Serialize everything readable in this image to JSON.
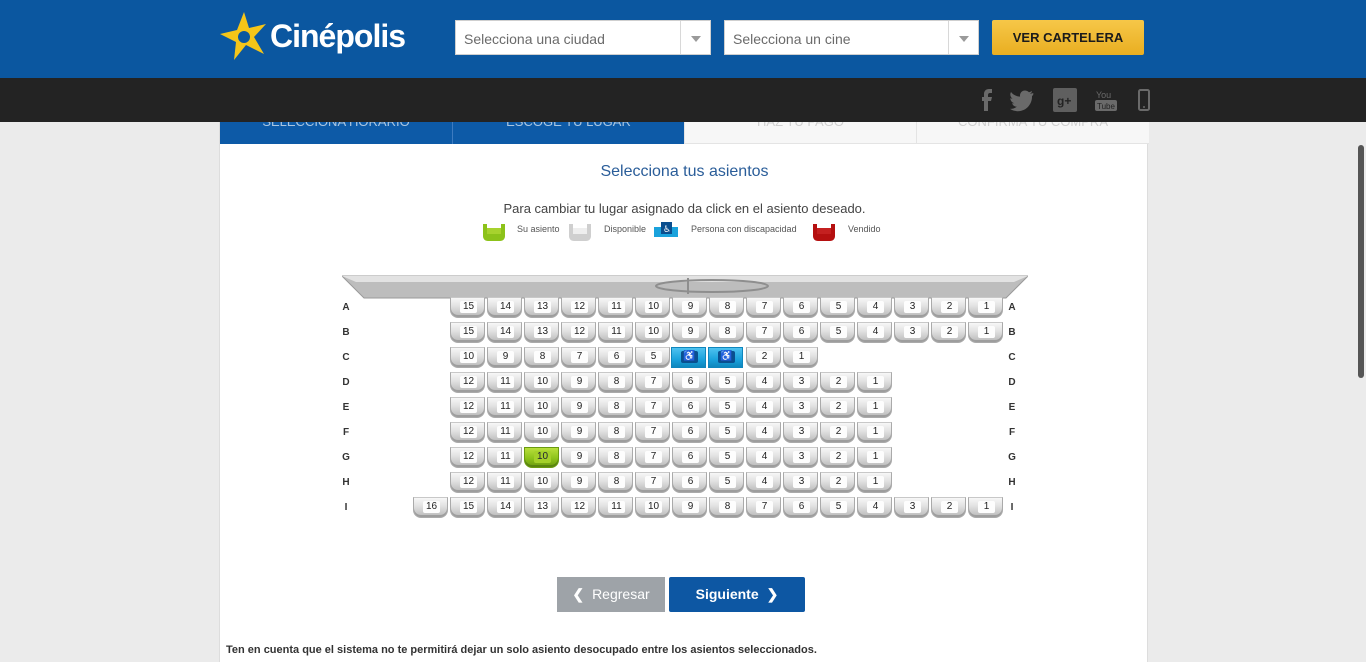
{
  "header": {
    "brand": "Cinépolis",
    "city_select": {
      "placeholder": "Selecciona una ciudad"
    },
    "cinema_select": {
      "placeholder": "Selecciona un cine"
    },
    "cta_label": "VER CARTELERA",
    "colors": {
      "header_bg": "#0b57a0",
      "cta": "#e9ae21",
      "social_bar": "#232323"
    },
    "social_icons": [
      "facebook-icon",
      "twitter-icon",
      "google-plus-icon",
      "youtube-icon",
      "mobile-icon"
    ]
  },
  "steps": [
    {
      "label": "SELECCIONA HORARIO",
      "state": "done"
    },
    {
      "label": "ESCOGE TU LUGAR",
      "state": "current"
    },
    {
      "label": "HAZ TU PAGO",
      "state": "pending"
    },
    {
      "label": "CONFIRMA TU COMPRA",
      "state": "pending"
    }
  ],
  "seatmap": {
    "title": "Selecciona tus asientos",
    "subtitle": "Para cambiar tu lugar asignado da click en el asiento deseado.",
    "legend": {
      "mine": "Su asiento",
      "available": "Disponible",
      "disabled": "Persona con discapacidad",
      "sold": "Vendido"
    },
    "rows": [
      {
        "label": "A",
        "seats": [
          "15",
          "14",
          "13",
          "12",
          "11",
          "10",
          "9",
          "8",
          "7",
          "6",
          "5",
          "4",
          "3",
          "2",
          "1"
        ]
      },
      {
        "label": "B",
        "seats": [
          "15",
          "14",
          "13",
          "12",
          "11",
          "10",
          "9",
          "8",
          "7",
          "6",
          "5",
          "4",
          "3",
          "2",
          "1"
        ]
      },
      {
        "label": "C",
        "seats": [
          "10",
          "9",
          "8",
          "7",
          "6",
          "5",
          "♿",
          "♿",
          "2",
          "1"
        ]
      },
      {
        "label": "D",
        "seats": [
          "12",
          "11",
          "10",
          "9",
          "8",
          "7",
          "6",
          "5",
          "4",
          "3",
          "2",
          "1"
        ]
      },
      {
        "label": "E",
        "seats": [
          "12",
          "11",
          "10",
          "9",
          "8",
          "7",
          "6",
          "5",
          "4",
          "3",
          "2",
          "1"
        ]
      },
      {
        "label": "F",
        "seats": [
          "12",
          "11",
          "10",
          "9",
          "8",
          "7",
          "6",
          "5",
          "4",
          "3",
          "2",
          "1"
        ]
      },
      {
        "label": "G",
        "seats": [
          "12",
          "11",
          "10",
          "9",
          "8",
          "7",
          "6",
          "5",
          "4",
          "3",
          "2",
          "1"
        ]
      },
      {
        "label": "H",
        "seats": [
          "12",
          "11",
          "10",
          "9",
          "8",
          "7",
          "6",
          "5",
          "4",
          "3",
          "2",
          "1"
        ]
      },
      {
        "label": "I",
        "seats": [
          "16",
          "15",
          "14",
          "13",
          "12",
          "11",
          "10",
          "9",
          "8",
          "7",
          "6",
          "5",
          "4",
          "3",
          "2",
          "1"
        ]
      }
    ],
    "selected": {
      "row": "G",
      "seat": "10"
    },
    "disabled_seats": {
      "row": "C"
    }
  },
  "actions": {
    "back_label": "Regresar",
    "next_label": "Siguiente"
  },
  "note": "Ten en cuenta que el sistema no te permitirá dejar un solo asiento desocupado entre los asientos seleccionados."
}
